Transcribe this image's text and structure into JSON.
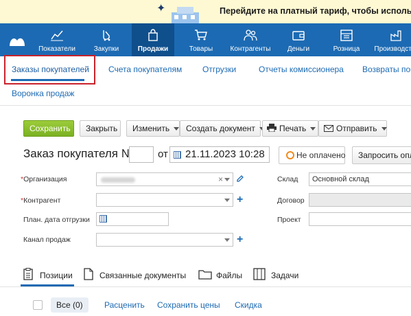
{
  "promo": {
    "text": "Перейдите на платный тариф, чтобы использ"
  },
  "nav": {
    "items": [
      {
        "label": "Показатели",
        "icon": "chart-icon"
      },
      {
        "label": "Закупки",
        "icon": "purchases-icon"
      },
      {
        "label": "Продажи",
        "icon": "bag-icon",
        "active": true
      },
      {
        "label": "Товары",
        "icon": "cart-icon"
      },
      {
        "label": "Контрагенты",
        "icon": "people-icon"
      },
      {
        "label": "Деньги",
        "icon": "wallet-icon"
      },
      {
        "label": "Розница",
        "icon": "cashbox-icon"
      },
      {
        "label": "Производство",
        "icon": "factory-icon"
      }
    ]
  },
  "subtabs": {
    "items": [
      "Заказы покупателей",
      "Счета покупателям",
      "Отгрузки",
      "Отчеты комиссионера",
      "Возвраты пок"
    ],
    "second_row": "Воронка продаж"
  },
  "toolbar": {
    "save": "Сохранить",
    "close": "Закрыть",
    "edit": "Изменить",
    "create_doc": "Создать документ",
    "print": "Печать",
    "send": "Отправить"
  },
  "doc": {
    "title": "Заказ покупателя №",
    "number": "",
    "from": "от",
    "date": "21.11.2023 10:28",
    "status": "Не оплачено",
    "request_payment": "Запросить опла"
  },
  "form": {
    "org_label": "Организация",
    "org_value": "",
    "counterparty_label": "Контрагент",
    "ship_date_label": "План. дата отгрузки",
    "channel_label": "Канал продаж",
    "warehouse_label": "Склад",
    "warehouse_value": "Основной склад",
    "contract_label": "Договор",
    "project_label": "Проект"
  },
  "bottom_tabs": {
    "positions": "Позиции",
    "linked_docs": "Связанные документы",
    "files": "Файлы",
    "tasks": "Задачи"
  },
  "positions_bar": {
    "all": "Все (0)",
    "reprice": "Расценить",
    "save_prices": "Сохранить цены",
    "discount": "Скидка"
  },
  "colors": {
    "nav_bg": "#1c6ab3",
    "accent": "#1c6ab3",
    "save_green": "#7bb122",
    "highlight_red": "#c8222a",
    "status_orange": "#f08a1c"
  }
}
